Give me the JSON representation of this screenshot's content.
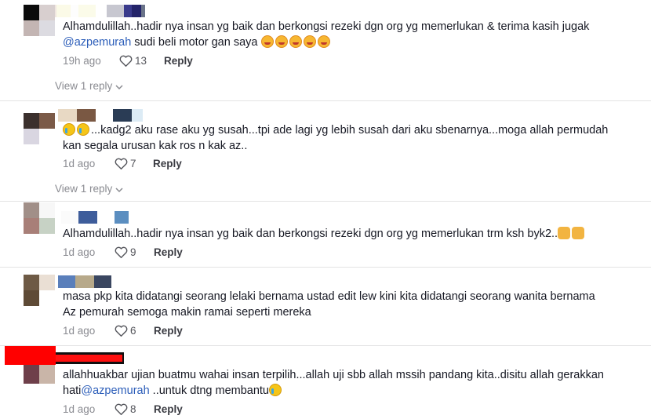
{
  "comments": [
    {
      "text": "Alhamdulillah..hadir nya insan yg baik dan berkongsi rezeki dgn org yg memerlukan & terima kasih jugak",
      "mention": "@azpemurah",
      "text_after": " sudi beli motor gan saya",
      "emoji": [
        "smiling-face-with-hearts",
        "smiling-face-with-hearts",
        "smiling-face-with-hearts",
        "smiling-face-with-hearts",
        "smiling-face-with-hearts"
      ],
      "time": "19h ago",
      "likes": "13",
      "reply_label": "Reply",
      "view_replies": "View 1 reply"
    },
    {
      "text": "...kadg2 aku rase aku yg susah...tpi ade lagi yg lebih susah dari aku sbenarnya...moga allah permudah",
      "text_line2": "kan segala urusan kak ros n kak az..",
      "emoji_prefix": [
        "crying-face",
        "crying-face"
      ],
      "time": "1d ago",
      "likes": "7",
      "reply_label": "Reply",
      "view_replies": "View 1 reply"
    },
    {
      "text": "Alhamdulillah..hadir nya insan yg baik dan berkongsi rezeki dgn org yg memerlukan trm ksh byk2..",
      "emoji": [
        "open-hands",
        "thumbs-up"
      ],
      "time": "1d ago",
      "likes": "9",
      "reply_label": "Reply"
    },
    {
      "text": "masa pkp kita didatangi seorang lelaki bernama ustad edit lew kini kita didatangi seorang wanita bernama",
      "text_line2": "Az pemurah semoga makin ramai seperti mereka",
      "time": "1d ago",
      "likes": "6",
      "reply_label": "Reply"
    },
    {
      "text": "allahhuakbar ujian buatmu wahai insan terpilih...allah uji sbb allah mssih pandang kita..disitu allah gerakkan",
      "text_line2_before": "hati",
      "mention": "@azpemurah",
      "text_line2_after": " ..untuk dtng membantu",
      "emoji": [
        "crying-face"
      ],
      "time": "1d ago",
      "likes": "8",
      "reply_label": "Reply"
    }
  ],
  "colors": {
    "text": "#161823",
    "mention": "#2b5db9",
    "meta": "#8a8b91",
    "divider": "#e3e3e4",
    "redaction_red": "#ff0000"
  },
  "icons": {
    "like": "heart-outline-icon",
    "expand": "chevron-down-icon"
  }
}
